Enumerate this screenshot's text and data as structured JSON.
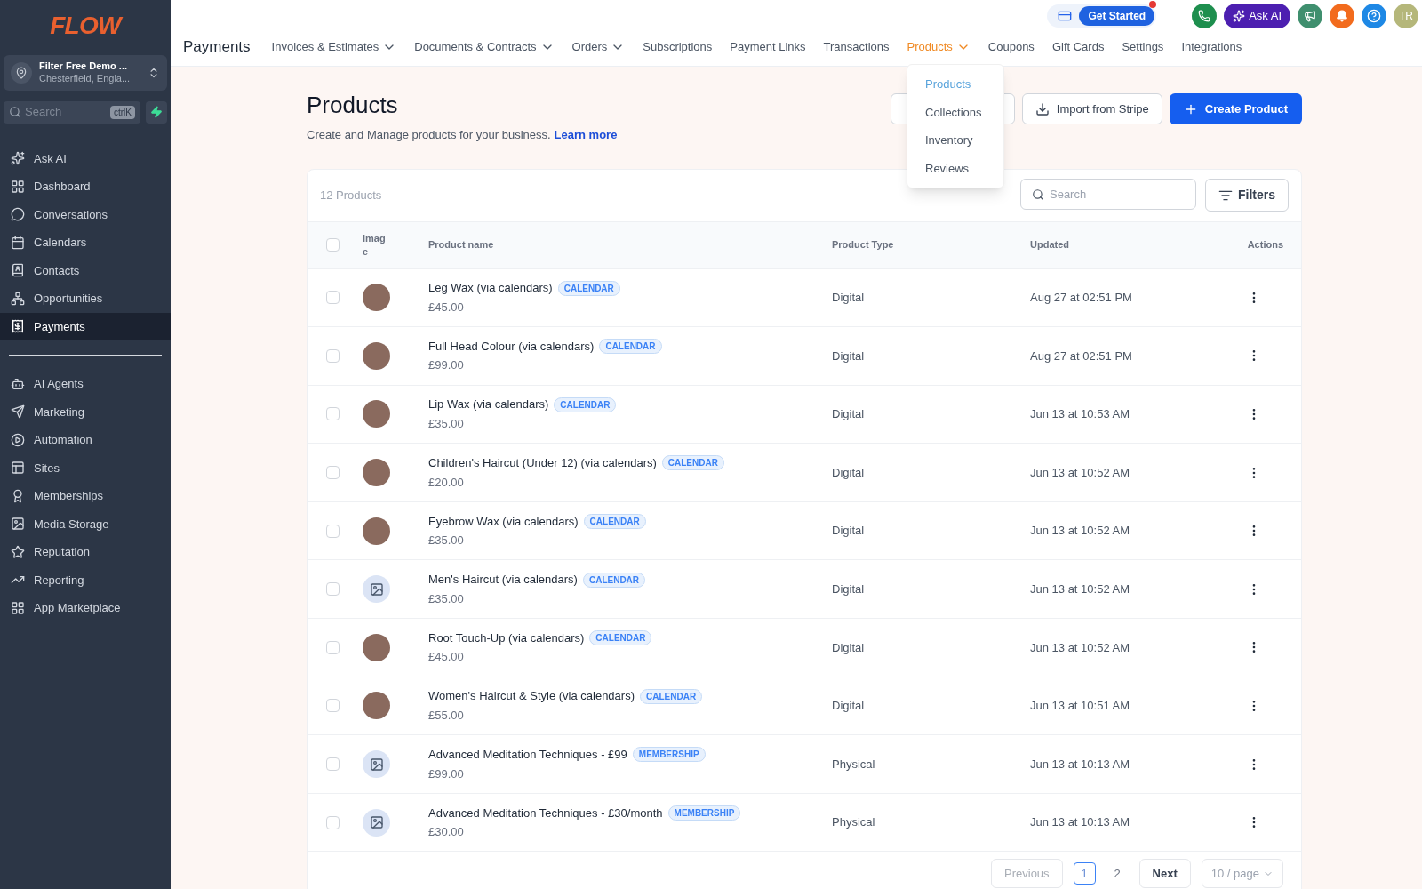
{
  "sidebar": {
    "logo": "FLOW",
    "account": {
      "name": "Filter Free Demo ...",
      "location": "Chesterfield, Engla..."
    },
    "search": {
      "placeholder": "Search",
      "shortcut": "ctrlK"
    },
    "items": [
      {
        "label": "Ask AI",
        "selected": false
      },
      {
        "label": "Dashboard",
        "selected": false
      },
      {
        "label": "Conversations",
        "selected": false
      },
      {
        "label": "Calendars",
        "selected": false
      },
      {
        "label": "Contacts",
        "selected": false
      },
      {
        "label": "Opportunities",
        "selected": false
      },
      {
        "label": "Payments",
        "selected": true
      }
    ],
    "items2": [
      {
        "label": "AI Agents",
        "selected": false
      },
      {
        "label": "Marketing",
        "selected": false
      },
      {
        "label": "Automation",
        "selected": false
      },
      {
        "label": "Sites",
        "selected": false
      },
      {
        "label": "Memberships",
        "selected": false
      },
      {
        "label": "Media Storage",
        "selected": false
      },
      {
        "label": "Reputation",
        "selected": false
      },
      {
        "label": "Reporting",
        "selected": false
      },
      {
        "label": "App Marketplace",
        "selected": false
      }
    ]
  },
  "topbar": {
    "get_started": "Get Started",
    "ask_ai": "Ask AI",
    "avatar": "TR"
  },
  "nav": {
    "title": "Payments",
    "tabs": [
      {
        "label": "Invoices & Estimates",
        "caret": true,
        "selected": false
      },
      {
        "label": "Documents & Contracts",
        "caret": true,
        "selected": false
      },
      {
        "label": "Orders",
        "caret": true,
        "selected": false
      },
      {
        "label": "Subscriptions",
        "caret": false,
        "selected": false
      },
      {
        "label": "Payment Links",
        "caret": false,
        "selected": false
      },
      {
        "label": "Transactions",
        "caret": false,
        "selected": false
      },
      {
        "label": "Products",
        "caret": true,
        "selected": true
      },
      {
        "label": "Coupons",
        "caret": false,
        "selected": false
      },
      {
        "label": "Gift Cards",
        "caret": false,
        "selected": false
      },
      {
        "label": "Settings",
        "caret": false,
        "selected": false
      },
      {
        "label": "Integrations",
        "caret": false,
        "selected": false
      }
    ]
  },
  "dropdown": [
    {
      "label": "Products",
      "selected": true
    },
    {
      "label": "Collections",
      "selected": false
    },
    {
      "label": "Inventory",
      "selected": false
    },
    {
      "label": "Reviews",
      "selected": false
    }
  ],
  "page": {
    "title": "Products",
    "subtitle": "Create and Manage products for your business.",
    "link": "Learn more",
    "buttons": {
      "import": "Import from Stripe",
      "create": "Create Product"
    }
  },
  "table": {
    "count": "12 Products",
    "search_placeholder": "Search",
    "filters": "Filters",
    "all_checked": false,
    "columns": [
      "Imag e",
      "Product name",
      "Product Type",
      "Updated",
      "Actions"
    ],
    "rows": [
      {
        "kind": "photo",
        "name": "Leg Wax (via calendars)",
        "tag": "CALENDAR",
        "price": "£45.00",
        "type": "Digital",
        "updated": "Aug 27 at 02:51 PM",
        "checked": false
      },
      {
        "kind": "photo",
        "name": "Full Head Colour (via calendars)",
        "tag": "CALENDAR",
        "price": "£99.00",
        "type": "Digital",
        "updated": "Aug 27 at 02:51 PM",
        "checked": false
      },
      {
        "kind": "photo",
        "name": "Lip Wax (via calendars)",
        "tag": "CALENDAR",
        "price": "£35.00",
        "type": "Digital",
        "updated": "Jun 13 at 10:53 AM",
        "checked": false
      },
      {
        "kind": "photo",
        "name": "Children's Haircut (Under 12) (via calendars)",
        "tag": "CALENDAR",
        "price": "£20.00",
        "type": "Digital",
        "updated": "Jun 13 at 10:52 AM",
        "checked": false
      },
      {
        "kind": "photo",
        "name": "Eyebrow Wax (via calendars)",
        "tag": "CALENDAR",
        "price": "£35.00",
        "type": "Digital",
        "updated": "Jun 13 at 10:52 AM",
        "checked": false
      },
      {
        "kind": "placeholder",
        "name": "Men's Haircut (via calendars)",
        "tag": "CALENDAR",
        "price": "£35.00",
        "type": "Digital",
        "updated": "Jun 13 at 10:52 AM",
        "checked": false
      },
      {
        "kind": "photo",
        "name": "Root Touch-Up (via calendars)",
        "tag": "CALENDAR",
        "price": "£45.00",
        "type": "Digital",
        "updated": "Jun 13 at 10:52 AM",
        "checked": false
      },
      {
        "kind": "photo",
        "name": "Women's Haircut & Style (via calendars)",
        "tag": "CALENDAR",
        "price": "£55.00",
        "type": "Digital",
        "updated": "Jun 13 at 10:51 AM",
        "checked": false
      },
      {
        "kind": "placeholder",
        "name": "Advanced Meditation Techniques - £99",
        "tag": "MEMBERSHIP",
        "price": "£99.00",
        "type": "Physical",
        "updated": "Jun 13 at 10:13 AM",
        "checked": false
      },
      {
        "kind": "placeholder",
        "name": "Advanced Meditation Techniques - £30/month",
        "tag": "MEMBERSHIP",
        "price": "£30.00",
        "type": "Physical",
        "updated": "Jun 13 at 10:13 AM",
        "checked": false
      }
    ]
  },
  "pagination": {
    "previous": "Previous",
    "pages": [
      {
        "label": "1",
        "selected": true
      },
      {
        "label": "2",
        "selected": false
      }
    ],
    "next": "Next",
    "per_page": "10 / page"
  }
}
